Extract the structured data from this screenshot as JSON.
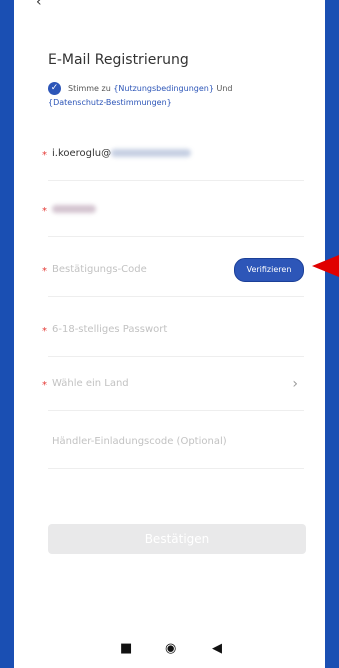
{
  "header": {
    "back_icon": "chevron-left-icon",
    "title": "E-Mail Registrierung"
  },
  "consent": {
    "checked": true,
    "agree_prefix": "Stimme zu",
    "terms_link": "{Nutzungsbedingungen}",
    "conjunction": "Und",
    "privacy_link": "{Datenschutz-Bestimmungen}"
  },
  "fields": {
    "email": {
      "value_prefix": "i.koeroglu@",
      "value_hidden": true,
      "required": true
    },
    "name": {
      "value_hidden": true,
      "required": true
    },
    "verification_code": {
      "placeholder": "Bestätigungs-Code",
      "required": true,
      "button_label": "Verifizieren"
    },
    "password": {
      "placeholder": "6-18-stelliges Passwort",
      "required": true
    },
    "country": {
      "placeholder": "Wähle ein Land",
      "required": true
    },
    "invitation": {
      "placeholder": "Händler-Einladungscode (Optional)",
      "required": false
    }
  },
  "confirm_label": "Bestätigen",
  "navbar": {
    "items": [
      "square-icon",
      "circle-icon",
      "triangle-left-icon"
    ]
  },
  "colors": {
    "accent": "#2d56b8",
    "required": "#e53935",
    "background": "#1a4fb3",
    "arrow": "#e00000"
  }
}
